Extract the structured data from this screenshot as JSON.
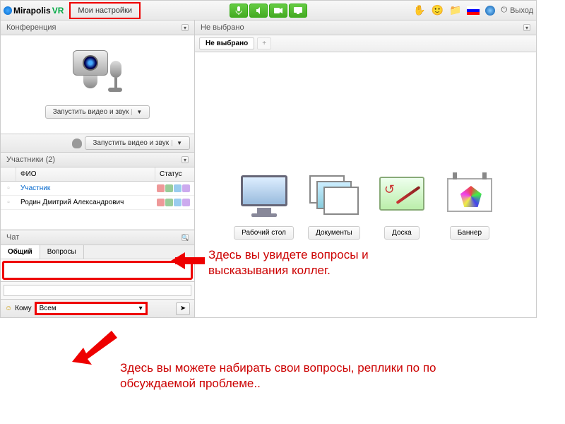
{
  "topbar": {
    "brand": "Mirapolis",
    "brand_suffix": "VR",
    "my_settings": "Мои настройки",
    "exit": "Выход"
  },
  "left": {
    "conference_title": "Конференция",
    "start_av": "Запустить видео и звук",
    "start_av2": "Запустить видео и звук",
    "participants_title": "Участники (2)",
    "col_name": "ФИО",
    "col_status": "Статус",
    "rows": [
      {
        "name": "Участник",
        "link": true
      },
      {
        "name": "Родин Дмитрий Александрович",
        "link": false
      }
    ],
    "chat_title": "Чат",
    "tab_general": "Общий",
    "tab_questions": "Вопросы",
    "komu_label": "Кому",
    "komu_value": "Всем"
  },
  "right": {
    "title": "Не выбрано",
    "tab": "Не выбрано",
    "items": [
      "Рабочий стол",
      "Документы",
      "Доска",
      "Баннер"
    ]
  },
  "annotations": {
    "a1": "Здесь вы увидете вопросы и высказывания коллег.",
    "a2": "Здесь вы можете набирать свои вопросы, реплики по по обсуждаемой проблеме.."
  }
}
